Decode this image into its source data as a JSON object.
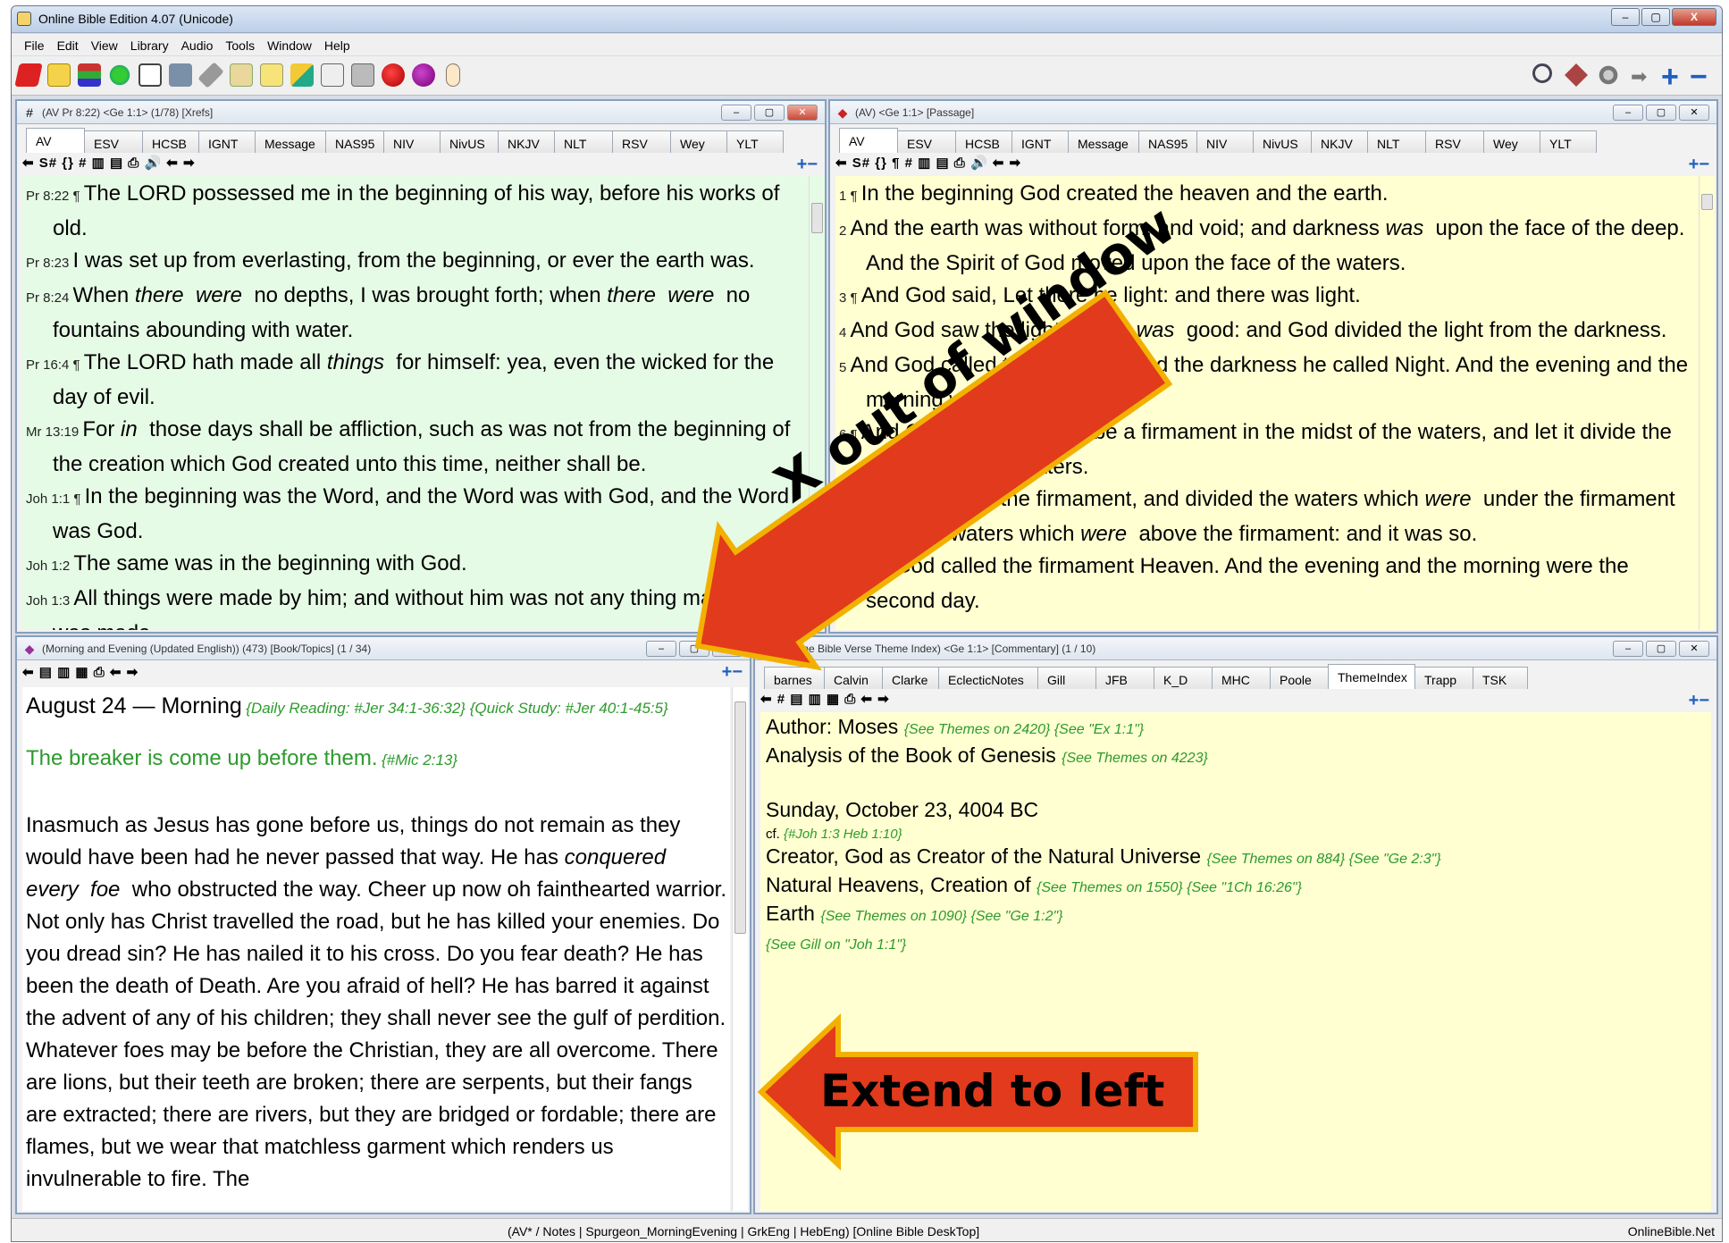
{
  "app": {
    "title": "Online Bible Edition 4.07  (Unicode)"
  },
  "menu": [
    "File",
    "Edit",
    "View",
    "Library",
    "Audio",
    "Tools",
    "Window",
    "Help"
  ],
  "toolbar_icons": [
    "book-red-icon",
    "notes-icon",
    "books-stack-icon",
    "globe-icon",
    "open-book-icon",
    "printer-icon",
    "link-icon",
    "clipboard-icon",
    "document-icon",
    "pencil-icon",
    "list-icon",
    "fax-icon",
    "balloon-red-icon",
    "balloon-purple-icon",
    "hand-icon",
    "search-tools-icon",
    "tools-icon",
    "gears-icon",
    "arrow-right-icon",
    "zoom-in-icon",
    "zoom-out-icon"
  ],
  "caption_buttons": [
    "–",
    "▢",
    "X"
  ],
  "window_buttons": [
    "–",
    "▢",
    "✕"
  ],
  "translation_tabs": [
    "AV",
    "ESV",
    "HCSB",
    "IGNT",
    "Message",
    "NAS95",
    "NIV",
    "NivUS",
    "NKJV",
    "NLT",
    "RSV",
    "Wey",
    "YLT"
  ],
  "xrefs_window": {
    "title": "(AV Pr 8:22) <Ge 1:1> (1/78) [Xrefs]",
    "strip": "⬅ S# {} # ▥ ▤ ⎙ 🔊 ⬅ ➡",
    "verses": [
      {
        "ref": "Pr 8:22 ¶",
        "html": "The LORD possessed me in the beginning of his way, before his works of old."
      },
      {
        "ref": "Pr 8:23",
        "html": "I was set up from everlasting, from the beginning, or ever the earth was."
      },
      {
        "ref": "Pr 8:24",
        "html": "When <i>there</i>&nbsp; <i>were</i>&nbsp; no depths, I was brought forth; when <i>there</i>&nbsp; <i>were</i>&nbsp; no fountains abounding with water."
      },
      {
        "ref": "Pr 16:4 ¶",
        "html": "The LORD hath made all <i>things</i>&nbsp; for himself: yea, even the wicked for the day of evil."
      },
      {
        "ref": "Mr 13:19",
        "html": "For <i>in</i>&nbsp; those days shall be affliction, such as was not from the beginning of the creation which God created unto this time, neither shall be."
      },
      {
        "ref": "Joh 1:1 ¶",
        "html": "In the beginning was the Word, and the Word was with God, and the Word was God."
      },
      {
        "ref": "Joh 1:2",
        "html": "The same was in the beginning with God."
      },
      {
        "ref": "Joh 1:3",
        "html": "All things were made by him; and without him was not any thing made that was made."
      }
    ]
  },
  "passage_window": {
    "title": "(AV) <Ge 1:1> [Passage]",
    "strip": "⬅ S# {} ¶ # ▥ ▤ ⎙ 🔊 ⬅ ➡",
    "verses": [
      {
        "ref": "1 ¶",
        "html": "In the beginning God created the heaven and the earth."
      },
      {
        "ref": "2",
        "html": "And the earth was without form, and void; and darkness <i>was</i>&nbsp; upon the face of the deep. And the Spirit of God moved upon the face of the waters."
      },
      {
        "ref": "3 ¶",
        "html": "And God said, Let there be light: and there was light."
      },
      {
        "ref": "4",
        "html": "And God saw the light, that <i>it</i>&nbsp; <i>was</i>&nbsp; good: and God divided the light from the darkness."
      },
      {
        "ref": "5",
        "html": "And God called the light Day, and the darkness he called Night. And the evening and the morning were the first day."
      },
      {
        "ref": "6 ¶",
        "html": "And God said, Let there be a firmament in the midst of the waters, and let it divide the waters from the waters."
      },
      {
        "ref": "7",
        "html": "And God made the firmament, and divided the waters which <i>were</i>&nbsp; under the firmament from the waters which <i>were</i>&nbsp; above the firmament: and it was so."
      },
      {
        "ref": "8",
        "html": "And God called the firmament Heaven. And the evening and the morning were the second day."
      }
    ]
  },
  "devotional_window": {
    "title": "(Morning and Evening  (Updated English)) (473) [Book/Topics] (1 / 34)",
    "strip": "⬅ ▤ ▥ ▦ ⎙ ⬅ ➡",
    "heading": "August 24 — Morning",
    "heading_note": "{Daily  Reading:  #Jer  34:1-36:32} {Quick  Study:  #Jer  40:1-45:5}",
    "quote": "The breaker is come up before them.",
    "quote_ref": "{#Mic  2:13}",
    "body": "Inasmuch as Jesus has gone before us, things do not remain as they would have been had he never passed that way. He has <i>conquered every</i>&nbsp; <i>foe</i>&nbsp; who obstructed the way. Cheer up now oh fainthearted warrior. Not only has Christ travelled the road, but he has killed your enemies. Do you dread sin? He has nailed it to his cross. Do you fear death? He has been the death of Death. Are you afraid of hell? He has barred it against the advent of any of his children; they shall never see the gulf of perdition. Whatever foes may be before the Christian, they are all overcome. There are lions, but their teeth are broken; there are serpents, but their fangs are extracted; there are rivers, but they are bridged or fordable; there are flames, but we wear that matchless garment which renders us invulnerable to fire. The"
  },
  "commentary_window": {
    "title": "(Online Bible Verse Theme Index) <Ge 1:1> [Commentary] (1 / 10)",
    "tabs": [
      "barnes",
      "Calvin",
      "Clarke",
      "EclecticNotes",
      "Gill",
      "JFB",
      "K_D",
      "MHC",
      "Poole",
      "ThemeIndex",
      "Trapp",
      "TSK"
    ],
    "strip": "⬅ # ▤ ▥ ▦ ⎙ ⬅ ➡",
    "entries": [
      {
        "text": "Author: Moses",
        "note": "{See  Themes  on  2420} {See  \"Ex  1:1\"}"
      },
      {
        "text": "Analysis of the Book of Genesis",
        "note": "{See  Themes  on  4223}"
      },
      {
        "text": "",
        "note": ""
      },
      {
        "text": "Sunday, October 23, 4004 BC",
        "note": ""
      },
      {
        "text": "cf.",
        "note": "{#Joh  1:3  Heb  1:10}",
        "small": true
      },
      {
        "text": "Creator, God as Creator of the Natural Universe",
        "note": "{See  Themes  on  884} {See  \"Ge  2:3\"}"
      },
      {
        "text": "Natural Heavens, Creation of",
        "note": "{See  Themes  on  1550} {See  \"1Ch  16:26\"}"
      },
      {
        "text": "Earth",
        "note": "{See  Themes  on  1090} {See  \"Ge  1:2\"}"
      },
      {
        "text": "",
        "note": "{See  Gill  on  \"Joh  1:1\"}"
      }
    ]
  },
  "callouts": {
    "top": "X out of window",
    "bottom": "Extend to left"
  },
  "status": {
    "center": "(AV* / Notes | Spurgeon_MorningEvening | GrkEng | HebEng)     [Online Bible DeskTop]",
    "right": "OnlineBible.Net"
  },
  "colors": {
    "passage_bg": "#ffffd2",
    "xref_bg": "#e6fbe6",
    "green_link": "#2d9a2d",
    "arrow_red": "#e03a1e",
    "arrow_border": "#f0b400"
  }
}
